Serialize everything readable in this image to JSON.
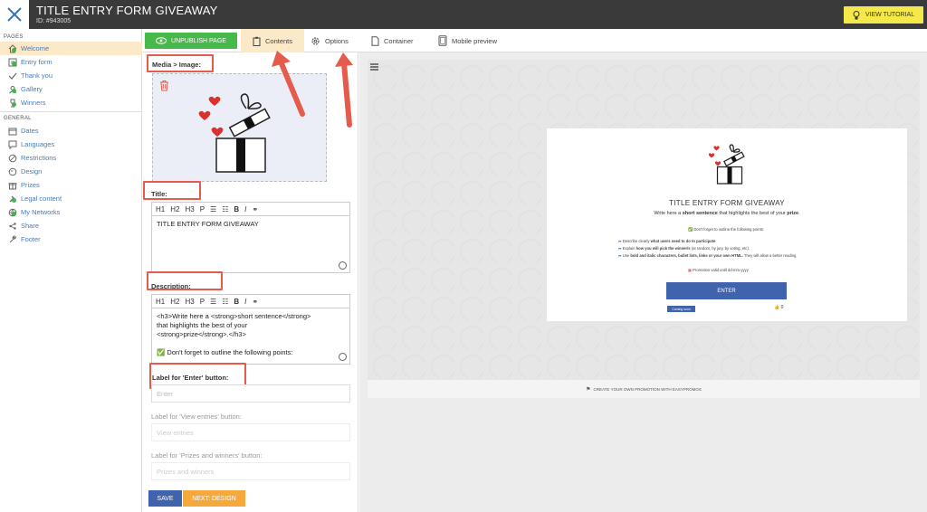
{
  "header": {
    "title": "TITLE ENTRY FORM GIVEAWAY",
    "id_label": "ID: #943005",
    "tutorial_label": "VIEW TUTORIAL"
  },
  "sidebar": {
    "pages_heading": "PAGES",
    "pages": [
      {
        "label": "Welcome",
        "icon": "home-icon",
        "status": "green"
      },
      {
        "label": "Entry form",
        "icon": "form-icon",
        "status": "green"
      },
      {
        "label": "Thank you",
        "icon": "check-icon",
        "status": "none"
      },
      {
        "label": "Gallery",
        "icon": "gallery-icon",
        "status": "green"
      },
      {
        "label": "Winners",
        "icon": "trophy-icon",
        "status": "green"
      }
    ],
    "general_heading": "GENERAL",
    "general": [
      {
        "label": "Dates",
        "icon": "calendar-icon"
      },
      {
        "label": "Languages",
        "icon": "speech-bubble-icon"
      },
      {
        "label": "Restrictions",
        "icon": "restriction-icon"
      },
      {
        "label": "Design",
        "icon": "palette-icon"
      },
      {
        "label": "Prizes",
        "icon": "gift-icon"
      },
      {
        "label": "Legal content",
        "icon": "gavel-icon"
      },
      {
        "label": "My Networks",
        "icon": "globe-icon"
      },
      {
        "label": "Share",
        "icon": "share-icon"
      },
      {
        "label": "Footer",
        "icon": "wrench-icon"
      }
    ]
  },
  "tabs": {
    "unpublish_label": "UNPUBLISH PAGE",
    "contents_label": "Contents",
    "options_label": "Options",
    "container_label": "Container",
    "mobile_label": "Mobile preview"
  },
  "form": {
    "media_label": "Media > Image:",
    "title_label": "Title:",
    "toolbar": [
      "H1",
      "H2",
      "H3",
      "P",
      "B",
      "I"
    ],
    "title_value": "TITLE ENTRY FORM GIVEAWAY",
    "description_label": "Description:",
    "description_lines": [
      "<h3>Write here a <strong>short sentence</strong>",
      "that highlights the best of your",
      "<strong>prize</strong>.</h3>",
      "",
      "✅ Don't forget to outline the following points:"
    ],
    "enter_label": "Label for 'Enter' button:",
    "enter_placeholder": "Enter",
    "view_entries_label": "Label for 'View entries' button:",
    "view_entries_placeholder": "View entries",
    "prizes_label": "Label for 'Prizes and winners' button:",
    "prizes_placeholder": "Prizes and winners",
    "save_label": "SAVE",
    "next_label": "NEXT: DESIGN"
  },
  "preview": {
    "title": "TITLE ENTRY FORM GIVEAWAY",
    "subtitle_pre": "Write here a ",
    "subtitle_bold": "short sentence",
    "subtitle_mid": " that highlights the best of your ",
    "subtitle_bold2": "prize",
    "subtitle_end": ".",
    "checklist": "✅ Don't forget to outline the following points:",
    "bullet1_pre": "Describe clearly ",
    "bullet1_bold": "what users need to do to participate",
    "bullet2_pre": "Explain ",
    "bullet2_bold": "how you will pick the winner/s",
    "bullet2_post": " (at random, by jury, by voting, etc).",
    "bullet3_pre": "Use ",
    "bullet3_bold": "bold and italic characters, bullet lists, links or your own HTML.",
    "bullet3_post": " They will allow a better reading.",
    "promo": "Promotion valid until dd-mm-yyyy",
    "enter_button": "ENTER",
    "coming_soon": "Coming soon",
    "likes_count": "0",
    "footer": "CREATE YOUR OWN PROMOTION WITH EASYPROMOS"
  },
  "colors": {
    "accent_orange": "#f5a93b",
    "primary_blue": "#3f63ad",
    "publish_green": "#47b84a",
    "annotation_red": "#e55b4c",
    "tutorial_yellow": "#f5e94a"
  }
}
